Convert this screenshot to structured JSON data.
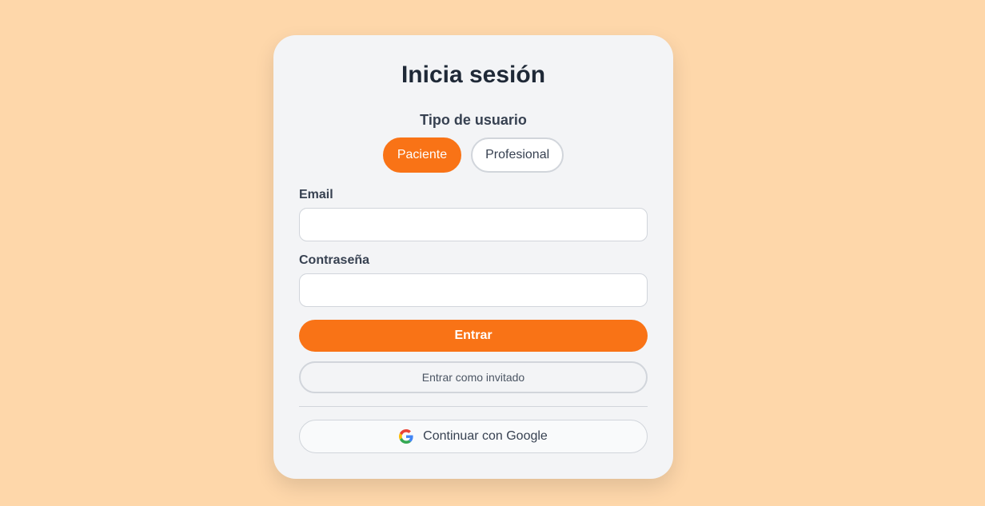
{
  "login": {
    "title": "Inicia sesión",
    "user_type_label": "Tipo de usuario",
    "roles": [
      {
        "label": "Paciente",
        "active": true
      },
      {
        "label": "Profesional",
        "active": false
      }
    ],
    "email_label": "Email",
    "email_value": "",
    "password_label": "Contraseña",
    "password_value": "",
    "submit_label": "Entrar",
    "guest_label": "Entrar como invitado",
    "google_label": "Continuar con Google",
    "google_icon": "google-g-logo-icon"
  },
  "colors": {
    "background": "#fed7aa",
    "card": "#f3f4f6",
    "accent": "#f97316",
    "text_dark": "#1f2937"
  }
}
